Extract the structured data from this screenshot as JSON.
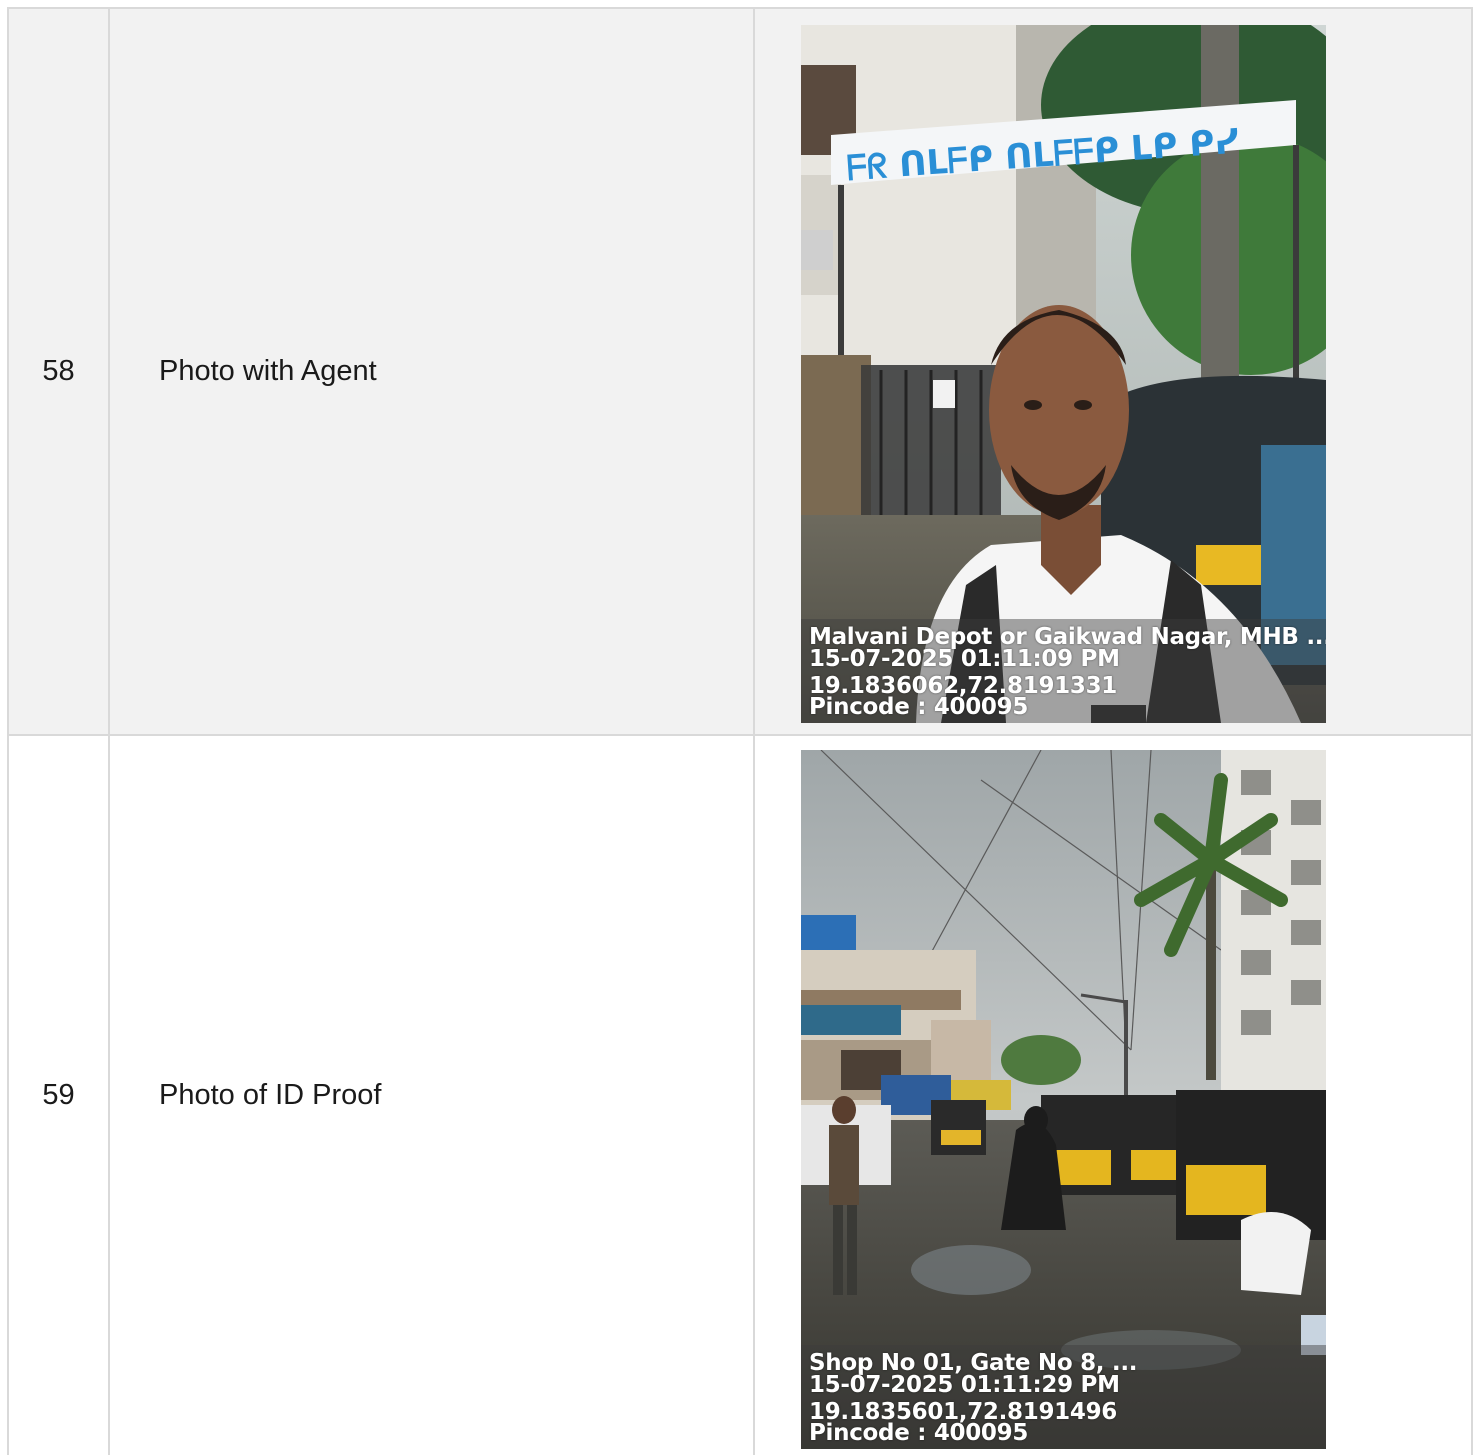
{
  "rows": [
    {
      "number": "58",
      "label": "Photo with Agent",
      "stamp": {
        "location": "Malvani Depot or Gaikwad Nagar, MHB ...",
        "datetime": "15-07-2025 01:11:09 PM",
        "coordinates": "19.1836062,72.8191331",
        "pincode": "Pincode : 400095"
      }
    },
    {
      "number": "59",
      "label": "Photo of ID Proof",
      "stamp": {
        "location": "Shop No 01, Gate No 8, ...",
        "datetime": "15-07-2025 01:11:29 PM",
        "coordinates": "19.1835601,72.8191496",
        "pincode": "Pincode : 400095"
      }
    }
  ],
  "colors": {
    "row_alt_bg": "#f2f2f2",
    "border": "#d9d9d9",
    "signboard": "#2a8fd6"
  }
}
